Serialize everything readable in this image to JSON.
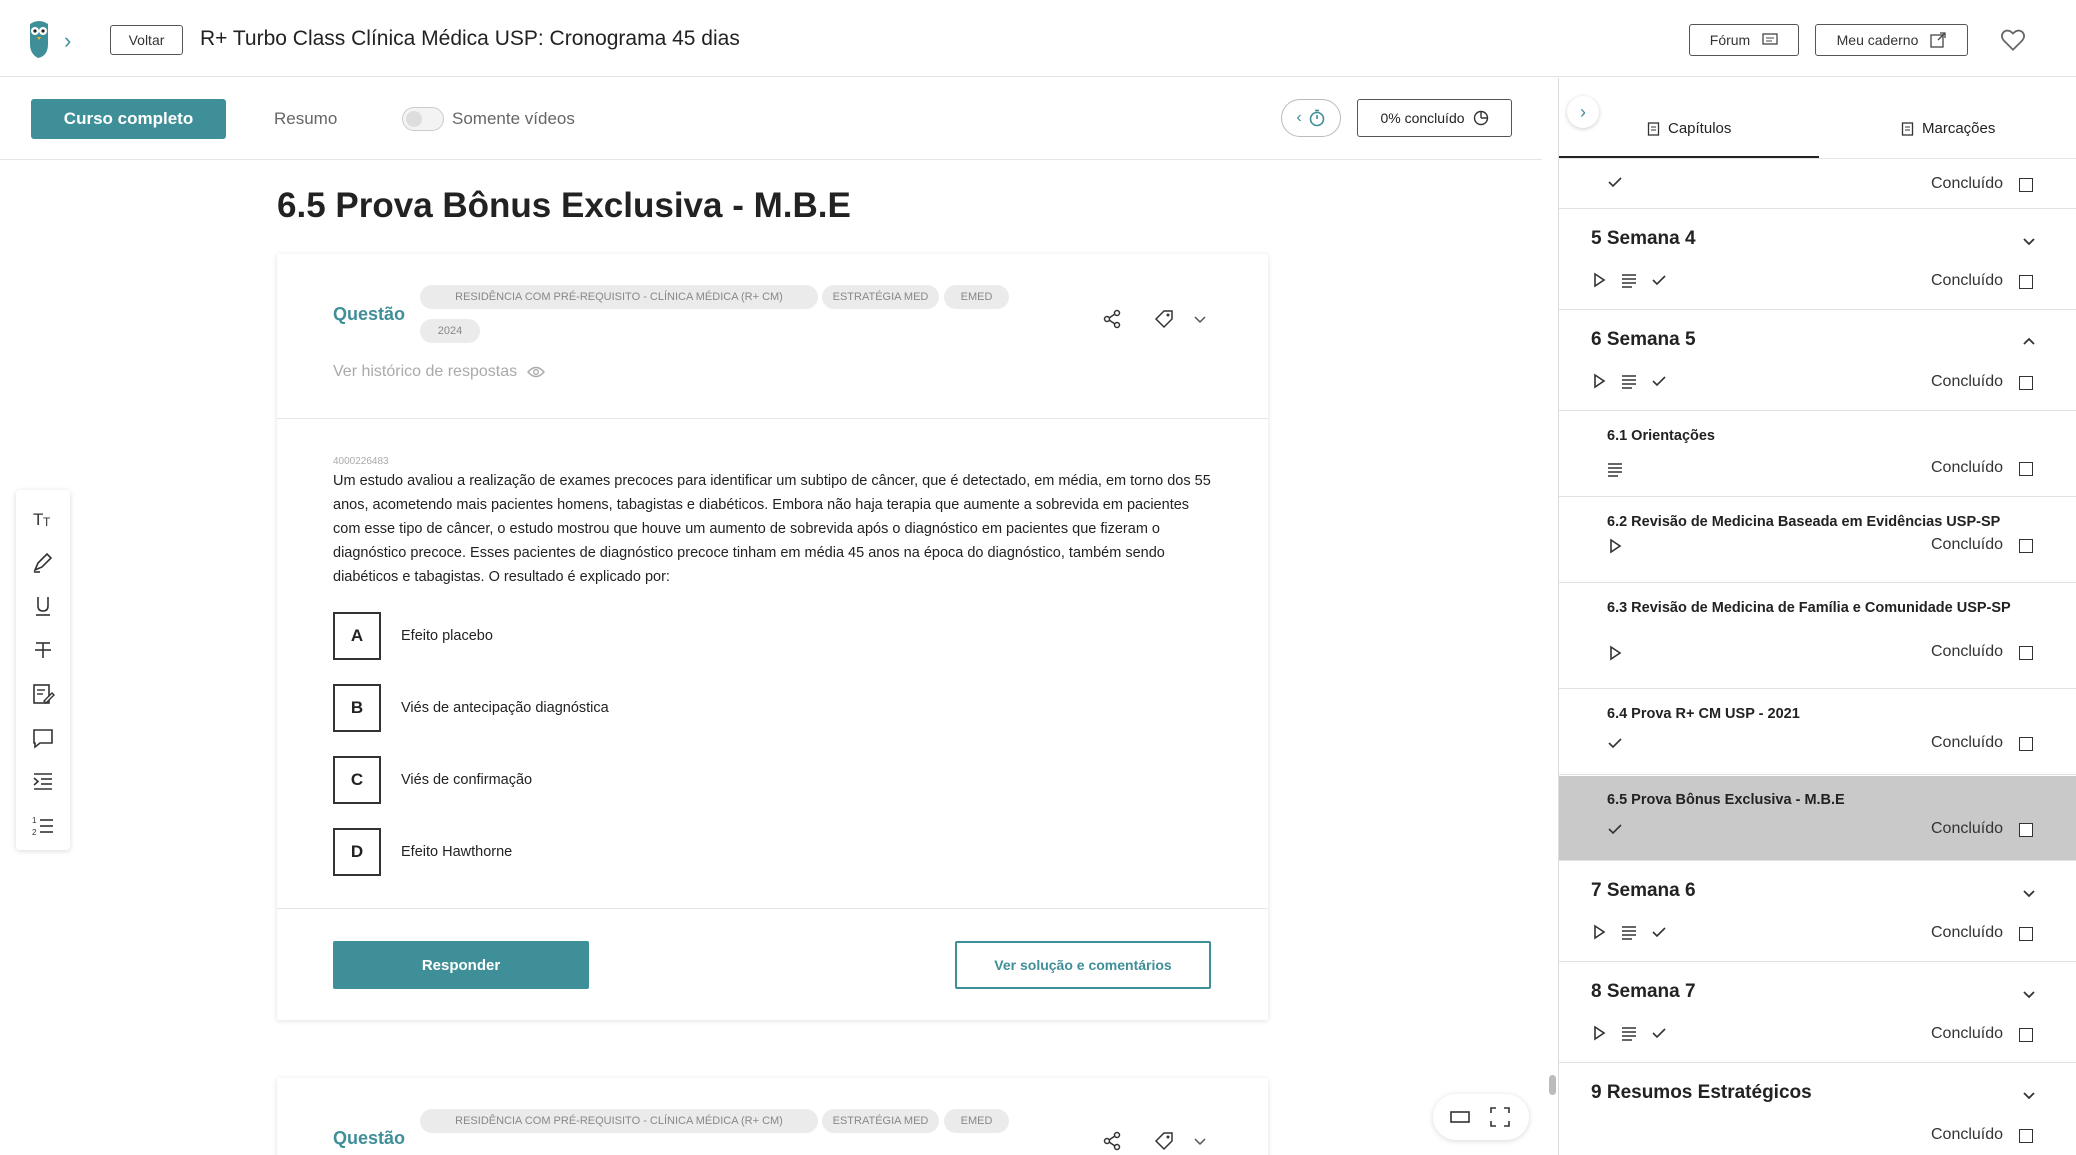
{
  "header": {
    "back_label": "Voltar",
    "title": "R+ Turbo Class Clínica Médica USP: Cronograma 45 dias",
    "forum_label": "Fórum",
    "notebook_label": "Meu caderno"
  },
  "subheader": {
    "full_course_label": "Curso completo",
    "summary_label": "Resumo",
    "videos_only_label": "Somente vídeos",
    "videos_only_on": false,
    "progress_label": "0% concluído"
  },
  "content": {
    "heading": "6.5 Prova Bônus Exclusiva - M.B.E",
    "question": {
      "label": "Questão",
      "tags": [
        "RESIDÊNCIA COM PRÉ-REQUISITO - CLÍNICA MÉDICA (R+ CM)",
        "ESTRATÉGIA MED",
        "EMED",
        "2024"
      ],
      "history_label": "Ver histórico de respostas",
      "id": "4000226483",
      "text": "Um estudo avaliou a realização de exames precoces para identificar um subtipo de câncer, que é detectado, em média, em torno dos 55 anos, acometendo mais pacientes homens, tabagistas e diabéticos. Embora não haja terapia que aumente a sobrevida em pacientes com esse tipo de câncer, o estudo mostrou que houve um aumento de sobrevida após o diagnóstico em pacientes que fizeram o diagnóstico precoce. Esses pacientes de diagnóstico precoce tinham em média 45 anos na época do diagnóstico, também sendo diabéticos e tabagistas. O resultado é explicado por:",
      "alternatives": [
        {
          "letter": "A",
          "text": "Efeito placebo"
        },
        {
          "letter": "B",
          "text": "Viés de antecipação diagnóstica"
        },
        {
          "letter": "C",
          "text": "Viés de confirmação"
        },
        {
          "letter": "D",
          "text": "Efeito Hawthorne"
        }
      ],
      "answer_label": "Responder",
      "solution_label": "Ver solução e comentários"
    },
    "next_question": {
      "label": "Questão",
      "tags": [
        "RESIDÊNCIA COM PRÉ-REQUISITO - CLÍNICA MÉDICA (R+ CM)",
        "ESTRATÉGIA MED",
        "EMED"
      ]
    }
  },
  "sidebar": {
    "tab_chapters": "Capítulos",
    "tab_bookmarks": "Marcações",
    "done_label": "Concluído",
    "items": [
      {
        "title": "",
        "level": "top-partial",
        "icons": [
          "check-icon"
        ]
      },
      {
        "title": "5 Semana 4",
        "level": "week",
        "icons": [
          "play-icon",
          "text-icon",
          "check-icon"
        ],
        "expanded": false
      },
      {
        "title": "6 Semana 5",
        "level": "week",
        "icons": [
          "play-icon",
          "text-icon",
          "check-icon"
        ],
        "expanded": true
      },
      {
        "title": "6.1 Orientações",
        "level": "lesson",
        "icons": [
          "text-icon"
        ]
      },
      {
        "title": "6.2 Revisão de Medicina Baseada em Evidências USP-SP",
        "level": "lesson",
        "icons": [
          "play-icon"
        ]
      },
      {
        "title": "6.3 Revisão de Medicina de Família e Comunidade USP-SP",
        "level": "lesson",
        "icons": [
          "play-icon"
        ]
      },
      {
        "title": "6.4 Prova R+ CM USP - 2021",
        "level": "lesson",
        "icons": [
          "check-icon"
        ]
      },
      {
        "title": "6.5 Prova Bônus Exclusiva - M.B.E",
        "level": "lesson",
        "icons": [
          "check-icon"
        ],
        "active": true
      },
      {
        "title": "7 Semana 6",
        "level": "week",
        "icons": [
          "play-icon",
          "text-icon",
          "check-icon"
        ],
        "expanded": false
      },
      {
        "title": "8 Semana 7",
        "level": "week",
        "icons": [
          "play-icon",
          "text-icon",
          "check-icon"
        ],
        "expanded": false
      },
      {
        "title": "9 Resumos Estratégicos",
        "level": "week",
        "icons": [],
        "expanded": false
      }
    ]
  },
  "colors": {
    "accent": "#3f8f98",
    "active_row": "#c9c9c9"
  }
}
